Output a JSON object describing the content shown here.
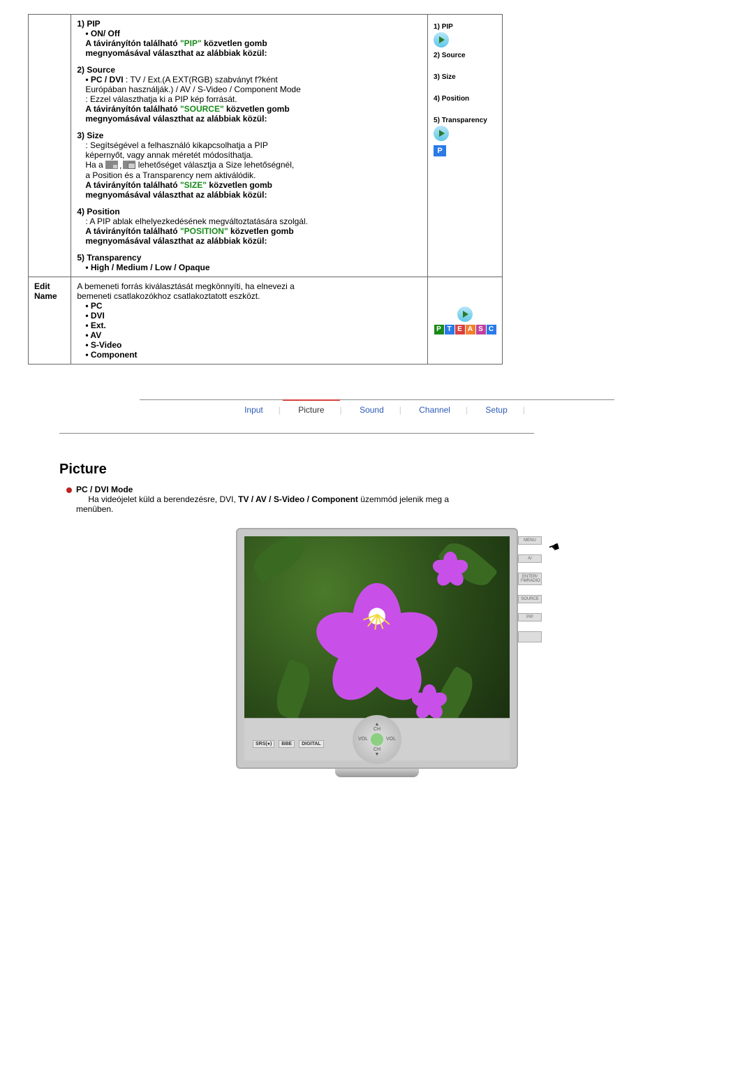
{
  "pip": {
    "item1_title": "1) PIP",
    "item1_onoff": "• ON/ Off",
    "item1_line_a": "A távirányítón található ",
    "item1_pip_label": "\"PIP\"",
    "item1_line_b": " közvetlen gomb",
    "item1_line_c": "megnyomásával választhat az alábbiak közül:",
    "item2_title": "2) Source",
    "item2_line_a": "• PC / DVI",
    "item2_line_a2": " : TV / Ext.(A EXT(RGB) szabványt f?ként",
    "item2_line_b": "Európában használják.) / AV / S-Video / Component Mode",
    "item2_line_c": ": Ezzel választhatja ki a PIP kép forrását.",
    "item2_line_d": "A távirányítón található ",
    "item2_source_label": "\"SOURCE\"",
    "item2_line_e": " közvetlen gomb",
    "item2_line_f": "megnyomásával választhat az alábbiak közül:",
    "item3_title": "3) Size",
    "item3_line_a": ": Segítségével a felhasználó kikapcsolhatja a PIP",
    "item3_line_b": "képernyőt, vagy annak méretét módosíthatja.",
    "item3_line_c_a": "Ha a ",
    "item3_line_c_b": " lehetőséget választja a Size lehetőségnél,",
    "item3_line_d": "a Position és a Transparency nem aktiválódik.",
    "item3_line_e": "A távirányítón található ",
    "item3_size_label": "\"SIZE\"",
    "item3_line_f": " közvetlen gomb",
    "item3_line_g": "megnyomásával választhat az alábbiak közül:",
    "item4_title": "4) Position",
    "item4_line_a": ": A PIP ablak elhelyezkedésének megváltoztatására szolgál.",
    "item4_line_b": "A távirányítón található ",
    "item4_position_label": "\"POSITION\"",
    "item4_line_c": " közvetlen gomb",
    "item4_line_d": "megnyomásával választhat az alábbiak közül:",
    "item5_title": "5) Transparency",
    "item5_line_a": "• High / Medium / Low / Opaque"
  },
  "pip_vis": {
    "v1": "1) PIP",
    "v2": "2) Source",
    "v3": "3) Size",
    "v4": "4) Position",
    "v5": "5) Transparency",
    "p": "P"
  },
  "editname": {
    "label": "Edit Name",
    "intro_a": "A bemeneti forrás kiválasztását megkönnyíti, ha elnevezi a",
    "intro_b": "bemeneti csatlakozókhoz csatlakoztatott eszközt.",
    "opt1": "• PC",
    "opt2": "• DVI",
    "opt3": "• Ext.",
    "opt4": "• AV",
    "opt5": "• S-Video",
    "opt6": "• Component",
    "letters": {
      "p": "P",
      "t": "T",
      "e": "E",
      "a": "A",
      "s": "S",
      "c": "C"
    }
  },
  "tabs": {
    "input": "Input",
    "picture": "Picture",
    "sound": "Sound",
    "channel": "Channel",
    "setup": "Setup"
  },
  "section": {
    "title": "Picture",
    "mode_title": "PC / DVI Mode",
    "mode_desc_a": "Ha videójelet küld a berendezésre, DVI, ",
    "mode_desc_b": "TV / AV / S-Video / Component",
    "mode_desc_c": " üzemmód jelenik meg a menüben."
  },
  "monitor": {
    "ch_up": "▲",
    "ch_lbl_top": "CH",
    "vol_l": "VOL",
    "vol_r": "VOL",
    "ch_lbl_bot": "CH",
    "ch_dn": "▼",
    "side": {
      "menu": "MENU",
      "av": "A/",
      "enter": "ENTER/\nFMRADIO",
      "source": "SOURCE",
      "pip": "PIP"
    },
    "logo1": "SRS(●)",
    "logo2": "BBE",
    "logo3": "DIGITAL"
  }
}
